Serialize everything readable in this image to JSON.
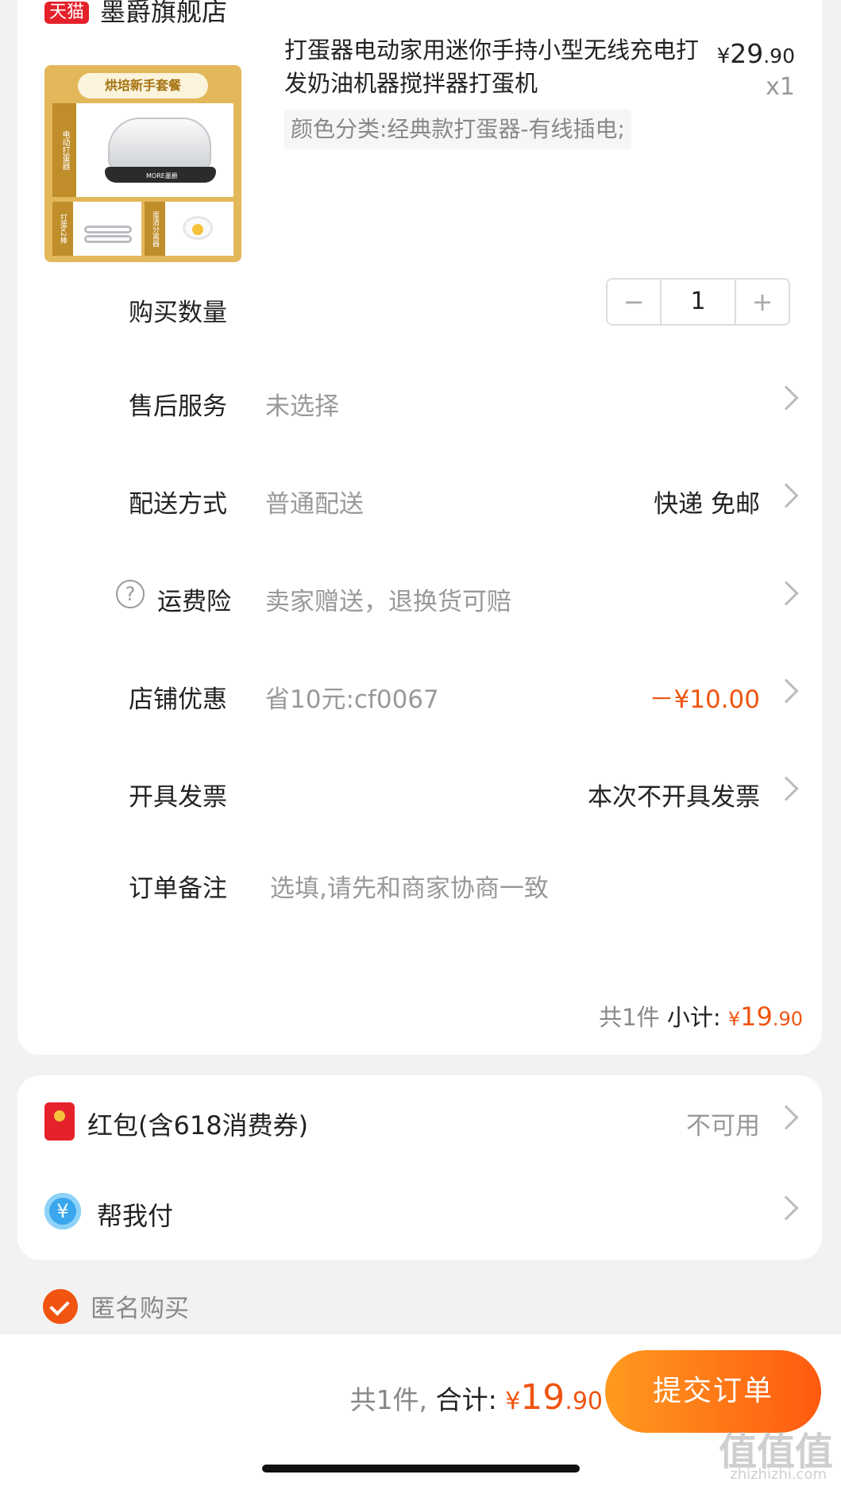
{
  "store": {
    "badge": "天猫",
    "name": "墨爵旗舰店"
  },
  "product": {
    "thumb_banner": "烘培新手套餐",
    "thumb_side_label": "电动打蛋器",
    "thumb_logo": "MORE墨爵",
    "thumb_sub1_label": "打蛋x2棒",
    "thumb_sub2_label": "蛋清分离器",
    "title": "打蛋器电动家用迷你手持小型无线充电打发奶油机器搅拌器打蛋机",
    "price_symbol": "¥",
    "price_int": "29",
    "price_dec": ".90",
    "qty": "x1",
    "sku": "颜色分类:经典款打蛋器-有线插电;"
  },
  "rows": {
    "quantity": {
      "label": "购买数量",
      "minus": "−",
      "value": "1",
      "plus": "+"
    },
    "after_sales": {
      "label": "售后服务",
      "value": "未选择"
    },
    "delivery": {
      "label": "配送方式",
      "value": "普通配送",
      "right": "快递 免邮"
    },
    "freight_ins": {
      "help": "?",
      "label": "运费险",
      "value": "卖家赠送，退换货可赔"
    },
    "discount": {
      "label": "店铺优惠",
      "value": "省10元:cf0067",
      "right": "－¥10.00"
    },
    "invoice": {
      "label": "开具发票",
      "right": "本次不开具发票"
    },
    "remark": {
      "label": "订单备注",
      "placeholder": "选填,请先和商家协商一致"
    }
  },
  "subtotal": {
    "count": "共1件",
    "label": "小计:",
    "symbol": "¥",
    "int": "19",
    "dec": ".90"
  },
  "extras": {
    "red_packet": {
      "label": "红包(含618消费券)",
      "right": "不可用"
    },
    "help_pay": {
      "icon": "¥",
      "label": "帮我付"
    }
  },
  "anonymous": {
    "label": "匿名购买",
    "checked": true
  },
  "footer": {
    "count": "共1件,",
    "label": "合计:",
    "symbol": "¥",
    "int": "19",
    "dec": ".90",
    "submit": "提交订单",
    "watermark": "值值值",
    "watermark_sub": "zhizhizhi.com"
  },
  "colors": {
    "accent": "#f05410",
    "tmall_red": "#e5212b",
    "pay_blue": "#3aa6ee"
  }
}
